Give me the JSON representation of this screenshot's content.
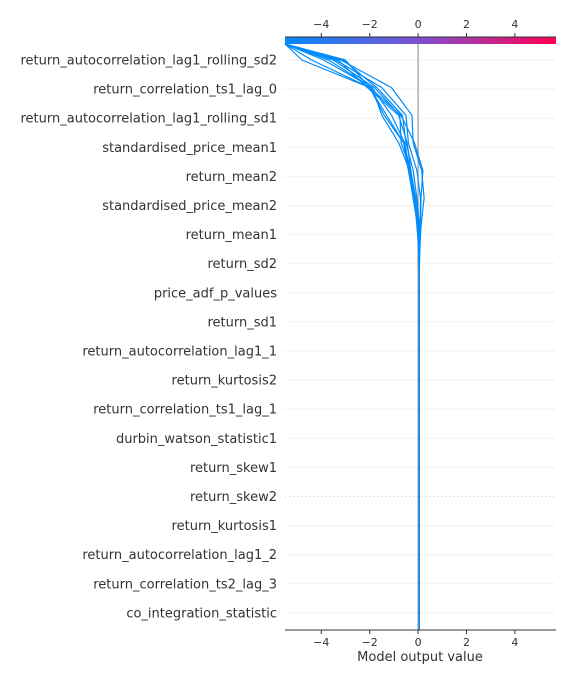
{
  "chart_data": {
    "type": "line",
    "subtype": "shap-decision-plot",
    "title": "",
    "xlabel": "Model output value",
    "ylabel": "",
    "xlim": [
      -5.5,
      5.7
    ],
    "xticks": [
      -4,
      -2,
      0,
      2,
      4
    ],
    "x_tick_labels": [
      "−4",
      "−2",
      "0",
      "2",
      "4"
    ],
    "base_value": 0,
    "colorbar": {
      "low_color": "#008bfb",
      "high_color": "#ff0052",
      "range": [
        -5.5,
        5.7
      ]
    },
    "features_top_to_bottom": [
      "return_autocorrelation_lag1_rolling_sd2",
      "return_correlation_ts1_lag_0",
      "return_autocorrelation_lag1_rolling_sd1",
      "standardised_price_mean1",
      "return_mean2",
      "standardised_price_mean2",
      "return_mean1",
      "return_sd2",
      "price_adf_p_values",
      "return_sd1",
      "return_autocorrelation_lag1_1",
      "return_kurtosis2",
      "return_correlation_ts1_lag_1",
      "durbin_watson_statistic1",
      "return_skew1",
      "return_skew2",
      "return_kurtosis1",
      "return_autocorrelation_lag1_2",
      "return_correlation_ts2_lag_3",
      "co_integration_statistic"
    ],
    "series": [
      {
        "values": [
          0.05,
          0.05,
          0.05,
          0.05,
          0.05,
          0.05,
          0.05,
          0.05,
          0.05,
          0.05,
          0.05,
          0.05,
          0.05,
          0.05,
          0.06,
          0.1,
          0.12,
          0.2,
          -0.15,
          -0.7,
          -2.0,
          -4.8,
          -5.5
        ]
      },
      {
        "values": [
          0.05,
          0.05,
          0.05,
          0.05,
          0.05,
          0.05,
          0.05,
          0.05,
          0.05,
          0.05,
          0.05,
          0.05,
          0.05,
          0.05,
          0.06,
          0.12,
          0.25,
          0.15,
          -0.2,
          -0.25,
          -1.1,
          -3.2,
          -5.5
        ]
      },
      {
        "values": [
          0.05,
          0.05,
          0.05,
          0.05,
          0.05,
          0.05,
          0.05,
          0.05,
          0.05,
          0.05,
          0.05,
          0.05,
          0.05,
          0.05,
          0.06,
          0.08,
          0.1,
          -0.05,
          -0.4,
          -0.5,
          -1.5,
          -3.4,
          -5.5
        ]
      },
      {
        "values": [
          0.05,
          0.05,
          0.05,
          0.05,
          0.05,
          0.05,
          0.05,
          0.05,
          0.05,
          0.05,
          0.05,
          0.05,
          0.05,
          0.05,
          0.06,
          0.05,
          -0.05,
          -0.2,
          -0.5,
          -0.65,
          -1.7,
          -3.1,
          -5.5
        ]
      },
      {
        "values": [
          0.05,
          0.05,
          0.05,
          0.05,
          0.05,
          0.05,
          0.05,
          0.05,
          0.05,
          0.05,
          0.05,
          0.05,
          0.05,
          0.05,
          0.06,
          0.06,
          -0.1,
          -0.3,
          -0.7,
          -0.75,
          -1.8,
          -3.5,
          -5.5
        ]
      },
      {
        "values": [
          0.05,
          0.05,
          0.05,
          0.05,
          0.05,
          0.05,
          0.05,
          0.05,
          0.05,
          0.05,
          0.05,
          0.05,
          0.05,
          0.05,
          0.05,
          0.0,
          -0.2,
          -0.4,
          -0.6,
          -1.3,
          -2.0,
          -3.0,
          -5.5
        ]
      },
      {
        "values": [
          0.05,
          0.05,
          0.05,
          0.05,
          0.05,
          0.05,
          0.05,
          0.05,
          0.05,
          0.05,
          0.05,
          0.05,
          0.05,
          0.05,
          0.04,
          0.0,
          -0.15,
          -0.35,
          -0.55,
          -1.1,
          -1.9,
          -3.7,
          -5.5
        ]
      },
      {
        "values": [
          0.05,
          0.05,
          0.05,
          0.05,
          0.05,
          0.05,
          0.05,
          0.05,
          0.05,
          0.05,
          0.05,
          0.05,
          0.05,
          0.05,
          0.03,
          -0.02,
          -0.2,
          -0.3,
          -0.45,
          -0.8,
          -2.1,
          -3.3,
          -5.5
        ]
      },
      {
        "values": [
          0.05,
          0.05,
          0.05,
          0.05,
          0.05,
          0.05,
          0.05,
          0.05,
          0.05,
          0.05,
          0.05,
          0.05,
          0.05,
          0.05,
          0.02,
          0.01,
          -0.1,
          -0.35,
          -0.8,
          -1.5,
          -1.9,
          -3.9,
          -5.5
        ]
      },
      {
        "values": [
          0.05,
          0.05,
          0.05,
          0.05,
          0.05,
          0.05,
          0.05,
          0.05,
          0.05,
          0.05,
          0.05,
          0.05,
          0.05,
          0.05,
          0.04,
          -0.05,
          -0.15,
          -0.3,
          -0.6,
          -1.4,
          -2.0,
          -4.4,
          -5.5
        ]
      }
    ]
  }
}
